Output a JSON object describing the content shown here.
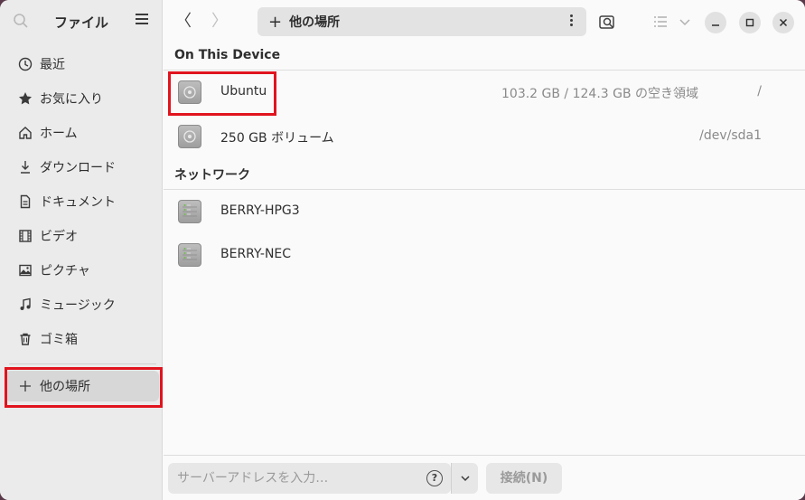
{
  "sidebar": {
    "title": "ファイル",
    "items": [
      {
        "label": "最近",
        "icon": "clock-icon"
      },
      {
        "label": "お気に入り",
        "icon": "star-icon"
      },
      {
        "label": "ホーム",
        "icon": "home-icon"
      },
      {
        "label": "ダウンロード",
        "icon": "download-icon"
      },
      {
        "label": "ドキュメント",
        "icon": "document-icon"
      },
      {
        "label": "ビデオ",
        "icon": "film-icon"
      },
      {
        "label": "ピクチャ",
        "icon": "picture-icon"
      },
      {
        "label": "ミュージック",
        "icon": "music-icon"
      },
      {
        "label": "ゴミ箱",
        "icon": "trash-icon"
      }
    ],
    "other_locations": {
      "label": "他の場所",
      "icon": "plus-icon"
    }
  },
  "toolbar": {
    "back": "〈",
    "forward": "〉",
    "path_label": "他の場所",
    "path_icon": "plus-icon"
  },
  "sections": {
    "device_heading": "On This Device",
    "network_heading": "ネットワーク"
  },
  "devices": [
    {
      "name": "Ubuntu",
      "info": "103.2 GB / 124.3 GB の空き領域",
      "path": "/"
    },
    {
      "name": "250 GB ボリューム",
      "info": "",
      "path": "/dev/sda1"
    }
  ],
  "network": [
    {
      "name": "BERRY-HPG3"
    },
    {
      "name": "BERRY-NEC"
    }
  ],
  "bottom": {
    "address_placeholder": "サーバーアドレスを入力…",
    "help": "?",
    "connect_label": "接続(N)"
  },
  "colors": {
    "highlight": "#e1141e",
    "sidebar_bg": "#ebebeb",
    "active_bg": "#d7d7d7"
  }
}
